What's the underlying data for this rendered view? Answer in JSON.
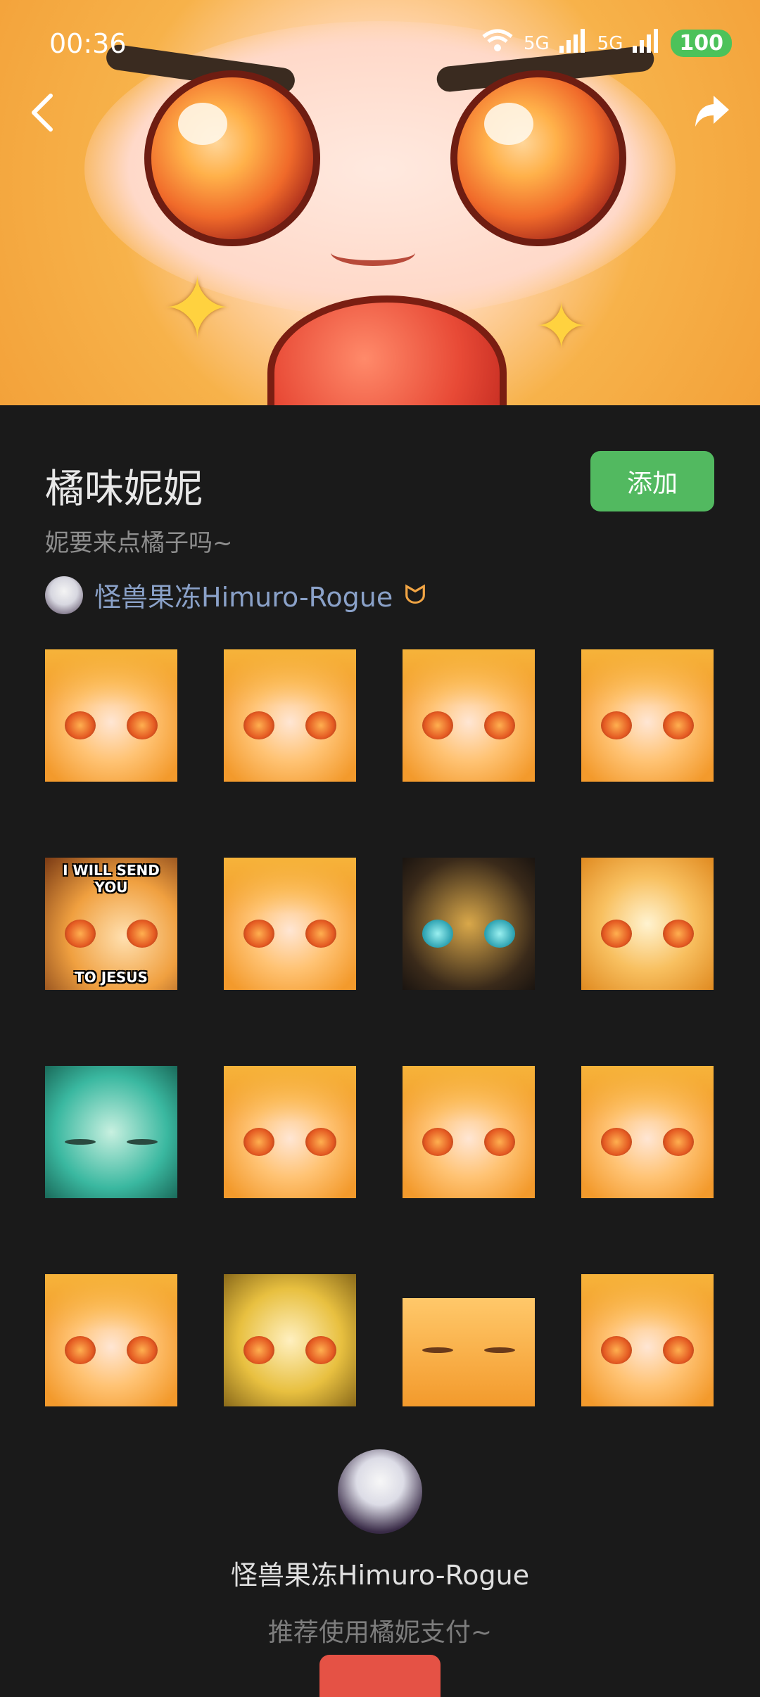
{
  "status_bar": {
    "time": "00:36",
    "network_1": "5G",
    "network_2": "5G",
    "battery": "100"
  },
  "nav": {
    "back_icon": "chevron-left",
    "share_icon": "share-arrow"
  },
  "sticker_pack": {
    "title": "橘味妮妮",
    "subtitle": "妮要来点橘子吗~",
    "add_button": "添加",
    "author_name": "怪兽果冻Himuro-Rogue",
    "author_badge": "ᗢ"
  },
  "stickers": [
    {
      "top_text": "",
      "bottom_text": ""
    },
    {
      "top_text": "",
      "bottom_text": ""
    },
    {
      "top_text": "",
      "bottom_text": ""
    },
    {
      "top_text": "",
      "bottom_text": ""
    },
    {
      "top_text": "I WILL SEND YOU",
      "bottom_text": "TO JESUS"
    },
    {
      "top_text": "",
      "bottom_text": ""
    },
    {
      "top_text": "",
      "bottom_text": ""
    },
    {
      "top_text": "",
      "bottom_text": ""
    },
    {
      "top_text": "",
      "bottom_text": ""
    },
    {
      "top_text": "",
      "bottom_text": ""
    },
    {
      "top_text": "",
      "bottom_text": ""
    },
    {
      "top_text": "",
      "bottom_text": ""
    },
    {
      "top_text": "",
      "bottom_text": ""
    },
    {
      "top_text": "",
      "bottom_text": ""
    },
    {
      "top_text": "",
      "bottom_text": ""
    },
    {
      "top_text": "",
      "bottom_text": ""
    }
  ],
  "author_footer": {
    "name": "怪兽果冻Himuro-Rogue",
    "message": "推荐使用橘妮支付~"
  },
  "colors": {
    "background": "#1a1a1a",
    "add_button": "#52b960",
    "author_link": "#8aa1c8",
    "support_button": "#e55245"
  }
}
